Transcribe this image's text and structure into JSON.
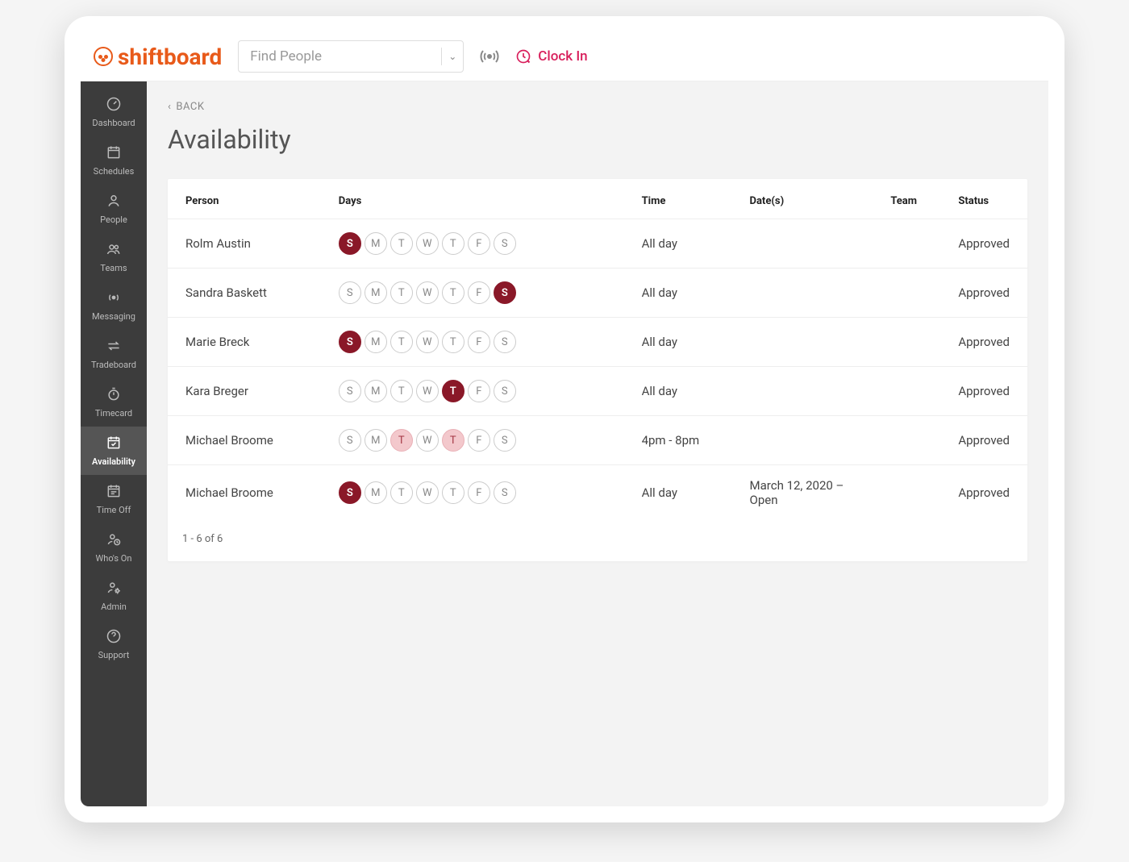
{
  "brand": "shiftboard",
  "search": {
    "placeholder": "Find People"
  },
  "clock_in_label": "Clock In",
  "sidebar": {
    "items": [
      {
        "label": "Dashboard",
        "icon": "gauge"
      },
      {
        "label": "Schedules",
        "icon": "calendar"
      },
      {
        "label": "People",
        "icon": "person"
      },
      {
        "label": "Teams",
        "icon": "people"
      },
      {
        "label": "Messaging",
        "icon": "broadcast"
      },
      {
        "label": "Tradeboard",
        "icon": "swap"
      },
      {
        "label": "Timecard",
        "icon": "stopwatch"
      },
      {
        "label": "Availability",
        "icon": "cal-check",
        "active": true
      },
      {
        "label": "Time Off",
        "icon": "cal-range"
      },
      {
        "label": "Who's On",
        "icon": "person-clock"
      },
      {
        "label": "Admin",
        "icon": "person-gear"
      },
      {
        "label": "Support",
        "icon": "help"
      }
    ]
  },
  "back_label": "BACK",
  "page_title": "Availability",
  "table": {
    "headers": [
      "Person",
      "Days",
      "Time",
      "Date(s)",
      "Team",
      "Status"
    ],
    "day_labels": [
      "S",
      "M",
      "T",
      "W",
      "T",
      "F",
      "S"
    ],
    "rows": [
      {
        "person": "Rolm Austin",
        "days": [
          "selected",
          "",
          "",
          "",
          "",
          "",
          ""
        ],
        "time": "All day",
        "dates": "",
        "team": "",
        "status": "Approved"
      },
      {
        "person": "Sandra Baskett",
        "days": [
          "",
          "",
          "",
          "",
          "",
          "",
          "selected"
        ],
        "time": "All day",
        "dates": "",
        "team": "",
        "status": "Approved"
      },
      {
        "person": "Marie Breck",
        "days": [
          "selected",
          "",
          "",
          "",
          "",
          "",
          ""
        ],
        "time": "All day",
        "dates": "",
        "team": "",
        "status": "Approved"
      },
      {
        "person": "Kara Breger",
        "days": [
          "",
          "",
          "",
          "",
          "selected",
          "",
          ""
        ],
        "time": "All day",
        "dates": "",
        "team": "",
        "status": "Approved"
      },
      {
        "person": "Michael Broome",
        "days": [
          "",
          "",
          "partial",
          "",
          "partial",
          "",
          ""
        ],
        "time": "4pm - 8pm",
        "dates": "",
        "team": "",
        "status": "Approved"
      },
      {
        "person": "Michael Broome",
        "days": [
          "selected",
          "",
          "",
          "",
          "",
          "",
          ""
        ],
        "time": "All day",
        "dates": "March 12, 2020 – Open",
        "team": "",
        "status": "Approved"
      }
    ]
  },
  "pagination": "1 - 6 of 6"
}
